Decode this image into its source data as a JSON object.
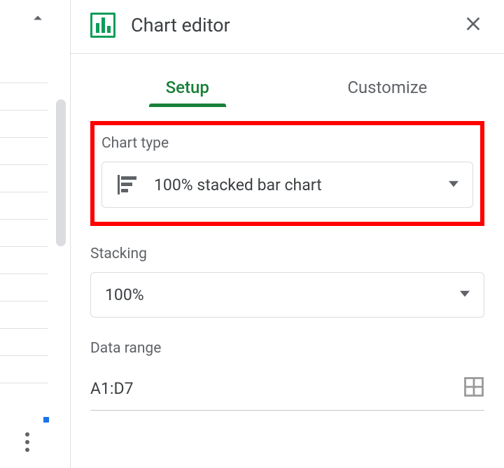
{
  "panel": {
    "title": "Chart editor",
    "tabs": {
      "setup": "Setup",
      "customize": "Customize"
    }
  },
  "chartType": {
    "label": "Chart type",
    "value": "100% stacked bar chart"
  },
  "stacking": {
    "label": "Stacking",
    "value": "100%"
  },
  "dataRange": {
    "label": "Data range",
    "value": "A1:D7"
  }
}
